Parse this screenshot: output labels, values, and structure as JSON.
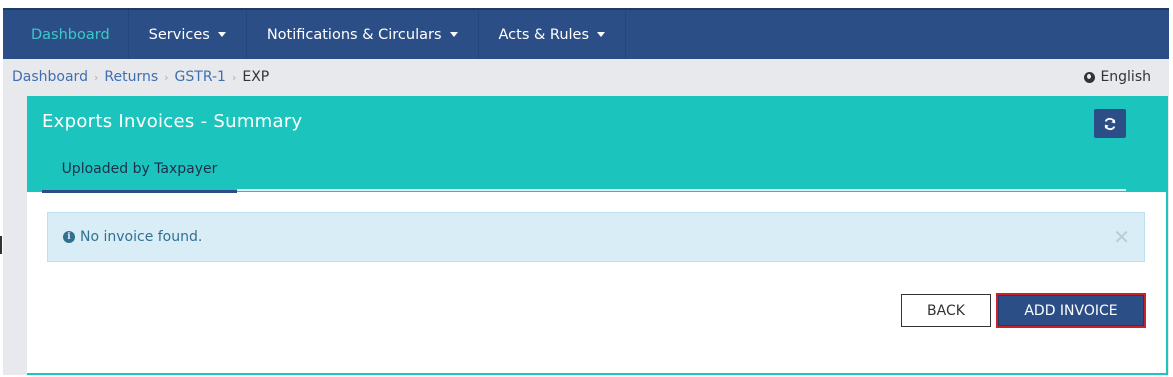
{
  "nav": {
    "items": [
      {
        "label": "Dashboard",
        "active": true,
        "dropdown": false
      },
      {
        "label": "Services",
        "active": false,
        "dropdown": true
      },
      {
        "label": "Notifications & Circulars",
        "active": false,
        "dropdown": true
      },
      {
        "label": "Acts & Rules",
        "active": false,
        "dropdown": true
      }
    ]
  },
  "breadcrumb": {
    "items": [
      "Dashboard",
      "Returns",
      "GSTR-1"
    ],
    "current": "EXP"
  },
  "language": {
    "label": "English",
    "icon": "globe-icon"
  },
  "card": {
    "title": "Exports Invoices - Summary",
    "refresh_icon": "refresh-icon",
    "tab_label": "Uploaded by Taxpayer"
  },
  "alert": {
    "message": "No invoice found.",
    "icon": "info-icon",
    "close_icon": "close-icon"
  },
  "actions": {
    "back_label": "BACK",
    "add_invoice_label": "ADD INVOICE"
  },
  "colors": {
    "navbar": "#2c4e86",
    "accent_teal": "#1bc4bd",
    "alert_bg": "#d9edf7",
    "highlight_border": "#c8232c"
  }
}
